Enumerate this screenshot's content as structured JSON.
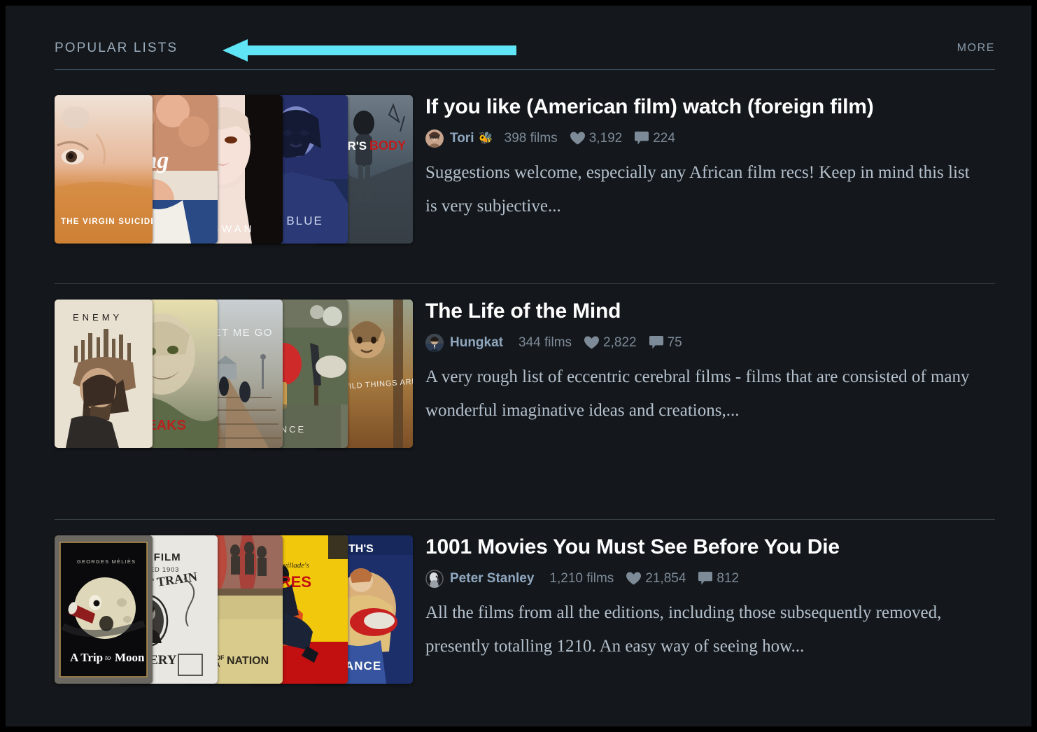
{
  "section": {
    "title": "POPULAR LISTS",
    "more_label": "MORE"
  },
  "annotation": {
    "type": "arrow-left",
    "color": "#5fe5f5",
    "points_to": "POPULAR LISTS"
  },
  "theme": {
    "background": "#14181c",
    "title_color": "#ffffff",
    "muted_color": "#7d8a97",
    "link_color": "#8fa7bf",
    "divider_color": "#3b444c"
  },
  "lists": [
    {
      "title": "If you like (American film) watch (foreign film)",
      "author": "Tori",
      "author_badge": "🐝",
      "avatar_icon": "avatar-tori",
      "film_count": "398 films",
      "likes": "3,192",
      "comments": "224",
      "description": "Suggestions welcome, especially any African film recs! Keep in mind this list is very subjective...",
      "posters": [
        "The Virgin Suicides",
        "Mustang",
        "Black Swan",
        "Perfect Blue",
        "Jennifer's Body"
      ]
    },
    {
      "title": "The Life of the Mind",
      "author": "Hungkat",
      "author_badge": "",
      "avatar_icon": "avatar-hungkat",
      "film_count": "344 films",
      "likes": "2,822",
      "comments": "75",
      "description": "A very rough list of eccentric cerebral films - films that are consisted of many wonderful imaginative ideas and creations,...",
      "posters": [
        "Enemy",
        "Twin Peaks",
        "Never Let Me Go",
        "Coherence",
        "Where the Wild Things Are"
      ]
    },
    {
      "title": "1001 Movies You Must See Before You Die",
      "author": "Peter Stanley",
      "author_badge": "",
      "avatar_icon": "avatar-peter-stanley",
      "film_count": "1,210 films",
      "likes": "21,854",
      "comments": "812",
      "description": "All the films from all the editions, including those subsequently removed, presently totalling 1210. An easy way of seeing how...",
      "posters": [
        "A Trip to the Moon",
        "The Great Train Robbery",
        "The Birth of a Nation",
        "Les Vampires",
        "Intolerance"
      ]
    }
  ]
}
